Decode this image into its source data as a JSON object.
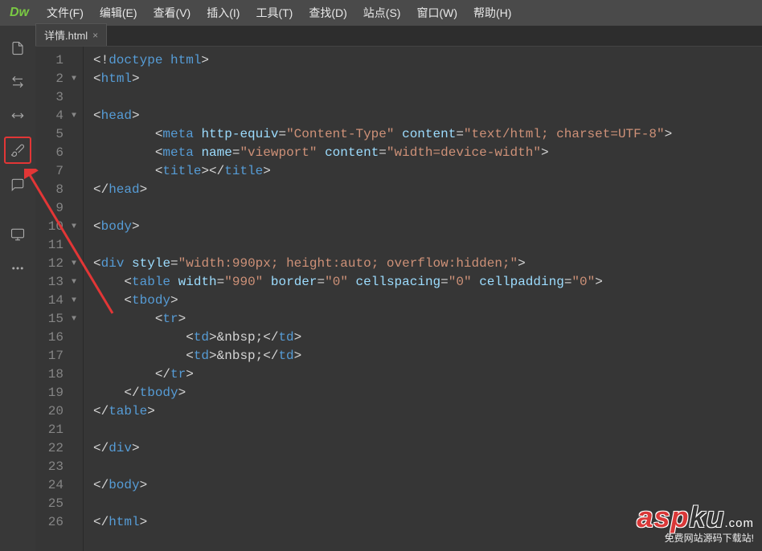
{
  "logo": "Dw",
  "menus": [
    "文件(F)",
    "编辑(E)",
    "查看(V)",
    "插入(I)",
    "工具(T)",
    "查找(D)",
    "站点(S)",
    "窗口(W)",
    "帮助(H)"
  ],
  "tab": {
    "label": "详情.html",
    "close": "×"
  },
  "sidebar_icons": [
    {
      "name": "file-icon",
      "glyph": "page"
    },
    {
      "name": "arrows-icon",
      "glyph": "arrows"
    },
    {
      "name": "ruler-icon",
      "glyph": "ruler"
    },
    {
      "name": "brush-icon",
      "glyph": "brush",
      "highlighted": true
    },
    {
      "name": "comment-icon",
      "glyph": "comment"
    },
    {
      "name": "monitor-icon",
      "glyph": "monitor"
    },
    {
      "name": "more-icon",
      "glyph": "dots"
    }
  ],
  "code_lines": [
    {
      "num": 1,
      "fold": "",
      "indent": 0,
      "tokens": [
        [
          "punct",
          "<!"
        ],
        [
          "doctype",
          "doctype html"
        ],
        [
          "punct",
          ">"
        ]
      ]
    },
    {
      "num": 2,
      "fold": "▼",
      "indent": 0,
      "tokens": [
        [
          "punct",
          "<"
        ],
        [
          "tag",
          "html"
        ],
        [
          "punct",
          ">"
        ]
      ]
    },
    {
      "num": 3,
      "fold": "",
      "indent": 0,
      "tokens": []
    },
    {
      "num": 4,
      "fold": "▼",
      "indent": 0,
      "tokens": [
        [
          "punct",
          "<"
        ],
        [
          "tag",
          "head"
        ],
        [
          "punct",
          ">"
        ]
      ]
    },
    {
      "num": 5,
      "fold": "",
      "indent": 2,
      "tokens": [
        [
          "punct",
          "<"
        ],
        [
          "tag",
          "meta"
        ],
        [
          "punct",
          " "
        ],
        [
          "attr",
          "http-equiv"
        ],
        [
          "punct",
          "="
        ],
        [
          "str",
          "\"Content-Type\""
        ],
        [
          "punct",
          " "
        ],
        [
          "attr",
          "content"
        ],
        [
          "punct",
          "="
        ],
        [
          "str",
          "\"text/html; charset=UTF-8\""
        ],
        [
          "punct",
          ">"
        ]
      ]
    },
    {
      "num": 6,
      "fold": "",
      "indent": 2,
      "tokens": [
        [
          "punct",
          "<"
        ],
        [
          "tag",
          "meta"
        ],
        [
          "punct",
          " "
        ],
        [
          "attr",
          "name"
        ],
        [
          "punct",
          "="
        ],
        [
          "str",
          "\"viewport\""
        ],
        [
          "punct",
          " "
        ],
        [
          "attr",
          "content"
        ],
        [
          "punct",
          "="
        ],
        [
          "str",
          "\"width=device-width\""
        ],
        [
          "punct",
          ">"
        ]
      ]
    },
    {
      "num": 7,
      "fold": "",
      "indent": 2,
      "tokens": [
        [
          "punct",
          "<"
        ],
        [
          "tag",
          "title"
        ],
        [
          "punct",
          "></"
        ],
        [
          "tag",
          "title"
        ],
        [
          "punct",
          ">"
        ]
      ]
    },
    {
      "num": 8,
      "fold": "",
      "indent": 0,
      "tokens": [
        [
          "punct",
          "</"
        ],
        [
          "tag",
          "head"
        ],
        [
          "punct",
          ">"
        ]
      ]
    },
    {
      "num": 9,
      "fold": "",
      "indent": 0,
      "tokens": []
    },
    {
      "num": 10,
      "fold": "▼",
      "indent": 0,
      "tokens": [
        [
          "punct",
          "<"
        ],
        [
          "tag",
          "body"
        ],
        [
          "punct",
          ">"
        ]
      ]
    },
    {
      "num": 11,
      "fold": "",
      "indent": 0,
      "tokens": []
    },
    {
      "num": 12,
      "fold": "▼",
      "indent": 0,
      "tokens": [
        [
          "punct",
          "<"
        ],
        [
          "tag",
          "div"
        ],
        [
          "punct",
          " "
        ],
        [
          "attr",
          "style"
        ],
        [
          "punct",
          "="
        ],
        [
          "str",
          "\"width:990px; height:auto; overflow:hidden;\""
        ],
        [
          "punct",
          ">"
        ]
      ]
    },
    {
      "num": 13,
      "fold": "▼",
      "indent": 1,
      "tokens": [
        [
          "punct",
          "<"
        ],
        [
          "tag",
          "table"
        ],
        [
          "punct",
          " "
        ],
        [
          "attr",
          "width"
        ],
        [
          "punct",
          "="
        ],
        [
          "str",
          "\"990\""
        ],
        [
          "punct",
          " "
        ],
        [
          "attr",
          "border"
        ],
        [
          "punct",
          "="
        ],
        [
          "str",
          "\"0\""
        ],
        [
          "punct",
          " "
        ],
        [
          "attr",
          "cellspacing"
        ],
        [
          "punct",
          "="
        ],
        [
          "str",
          "\"0\""
        ],
        [
          "punct",
          " "
        ],
        [
          "attr",
          "cellpadding"
        ],
        [
          "punct",
          "="
        ],
        [
          "str",
          "\"0\""
        ],
        [
          "punct",
          ">"
        ]
      ]
    },
    {
      "num": 14,
      "fold": "▼",
      "indent": 1,
      "tokens": [
        [
          "punct",
          "<"
        ],
        [
          "tag",
          "tbody"
        ],
        [
          "punct",
          ">"
        ]
      ]
    },
    {
      "num": 15,
      "fold": "▼",
      "indent": 2,
      "tokens": [
        [
          "punct",
          "<"
        ],
        [
          "tag",
          "tr"
        ],
        [
          "punct",
          ">"
        ]
      ]
    },
    {
      "num": 16,
      "fold": "",
      "indent": 3,
      "tokens": [
        [
          "punct",
          "<"
        ],
        [
          "tag",
          "td"
        ],
        [
          "punct",
          ">"
        ],
        [
          "entity",
          "&nbsp;"
        ],
        [
          "punct",
          "</"
        ],
        [
          "tag",
          "td"
        ],
        [
          "punct",
          ">"
        ]
      ]
    },
    {
      "num": 17,
      "fold": "",
      "indent": 3,
      "tokens": [
        [
          "punct",
          "<"
        ],
        [
          "tag",
          "td"
        ],
        [
          "punct",
          ">"
        ],
        [
          "entity",
          "&nbsp;"
        ],
        [
          "punct",
          "</"
        ],
        [
          "tag",
          "td"
        ],
        [
          "punct",
          ">"
        ]
      ]
    },
    {
      "num": 18,
      "fold": "",
      "indent": 2,
      "tokens": [
        [
          "punct",
          "</"
        ],
        [
          "tag",
          "tr"
        ],
        [
          "punct",
          ">"
        ]
      ]
    },
    {
      "num": 19,
      "fold": "",
      "indent": 1,
      "tokens": [
        [
          "punct",
          "</"
        ],
        [
          "tag",
          "tbody"
        ],
        [
          "punct",
          ">"
        ]
      ]
    },
    {
      "num": 20,
      "fold": "",
      "indent": 0,
      "tokens": [
        [
          "punct",
          "</"
        ],
        [
          "tag",
          "table"
        ],
        [
          "punct",
          ">"
        ]
      ]
    },
    {
      "num": 21,
      "fold": "",
      "indent": 0,
      "tokens": []
    },
    {
      "num": 22,
      "fold": "",
      "indent": 0,
      "tokens": [
        [
          "punct",
          "</"
        ],
        [
          "tag",
          "div"
        ],
        [
          "punct",
          ">"
        ]
      ]
    },
    {
      "num": 23,
      "fold": "",
      "indent": 0,
      "tokens": []
    },
    {
      "num": 24,
      "fold": "",
      "indent": 0,
      "tokens": [
        [
          "punct",
          "</"
        ],
        [
          "tag",
          "body"
        ],
        [
          "punct",
          ">"
        ]
      ]
    },
    {
      "num": 25,
      "fold": "",
      "indent": 0,
      "tokens": []
    },
    {
      "num": 26,
      "fold": "",
      "indent": 0,
      "tokens": [
        [
          "punct",
          "</"
        ],
        [
          "tag",
          "html"
        ],
        [
          "punct",
          ">"
        ]
      ]
    }
  ],
  "watermark": {
    "main1": "asp",
    "main2": "ku",
    "com": ".com",
    "subtitle": "免费网站源码下载站!"
  }
}
